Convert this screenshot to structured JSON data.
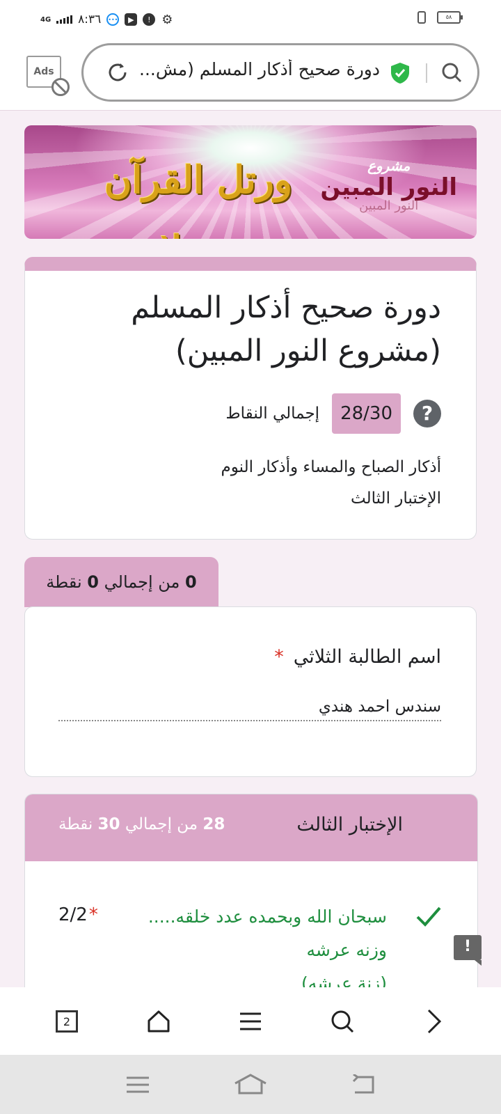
{
  "status_bar": {
    "time": "٨:٣٦",
    "network": "4G",
    "battery": "٥٨"
  },
  "browser": {
    "ads_label": "Ads",
    "url_text": "دورة صحيح أذكار المسلم (مش...",
    "tab_count": "2"
  },
  "banner": {
    "calligraphy": "ورتل القرآن ترتيلا",
    "project_small": "مشروع",
    "project_name": "النور المبين",
    "project_shadow": "النور المبين"
  },
  "form": {
    "title": "دورة صحيح أذكار المسلم (مشروع النور المبين)",
    "score_label": "إجمالي النقاط",
    "score_value": "28/30",
    "help_symbol": "?",
    "description_line1": "أذكار الصباح والمساء وأذكار النوم",
    "description_line2": "الإختبار الثالث"
  },
  "section1": {
    "points_earned": "0",
    "points_mid": "من إجمالي",
    "points_total": "0",
    "points_unit": "نقطة",
    "question": "اسم الطالبة الثلاثي",
    "required_mark": "*",
    "answer": "سندس احمد هندي"
  },
  "section2": {
    "title": "الإختبار الثالث",
    "points_earned": "28",
    "points_mid": "من إجمالي",
    "points_total": "30",
    "points_unit": "نقطة",
    "question_line1": "سبحان الله وبحمده عدد خلقه.....",
    "question_line2": "وزنه عرشه",
    "question_line3": "(زنة عرشه)",
    "question_score": "2/2",
    "required_mark": "*"
  },
  "feedback_symbol": "!",
  "colors": {
    "accent": "#dba7c8",
    "page_bg": "#f7eff5",
    "correct_green": "#1e8e3e",
    "required_red": "#d93025"
  }
}
